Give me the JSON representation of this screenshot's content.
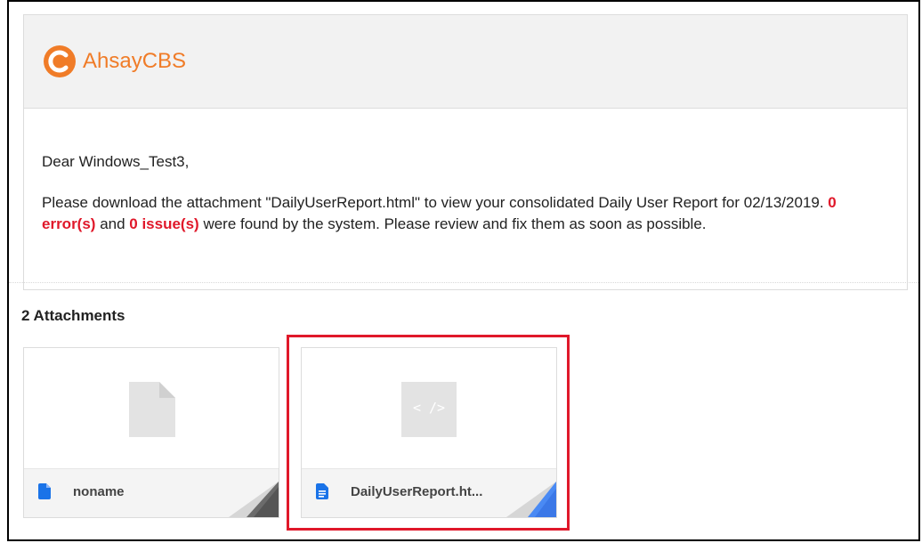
{
  "email": {
    "brand": "AhsayCBS",
    "greeting": "Dear Windows_Test3,",
    "message_part1": "Please download the attachment \"DailyUserReport.html\" to view your consolidated Daily User Report for 02/13/2019. ",
    "errors": "0 error(s)",
    "message_part2": " and ",
    "issues": "0 issue(s)",
    "message_part3": " were found by the system. Please review and fix them as soon as possible."
  },
  "attachments": {
    "title": "2 Attachments",
    "items": [
      {
        "name": "noname",
        "icon": "file-icon",
        "preview_icon": "generic-file-icon"
      },
      {
        "name": "DailyUserReport.ht...",
        "icon": "document-icon",
        "preview_icon": "code-file-icon",
        "preview_glyph": "< />"
      }
    ]
  },
  "colors": {
    "brand_orange": "#f07c28",
    "alert_red": "#e0182a",
    "file_blue": "#1a73e8"
  }
}
